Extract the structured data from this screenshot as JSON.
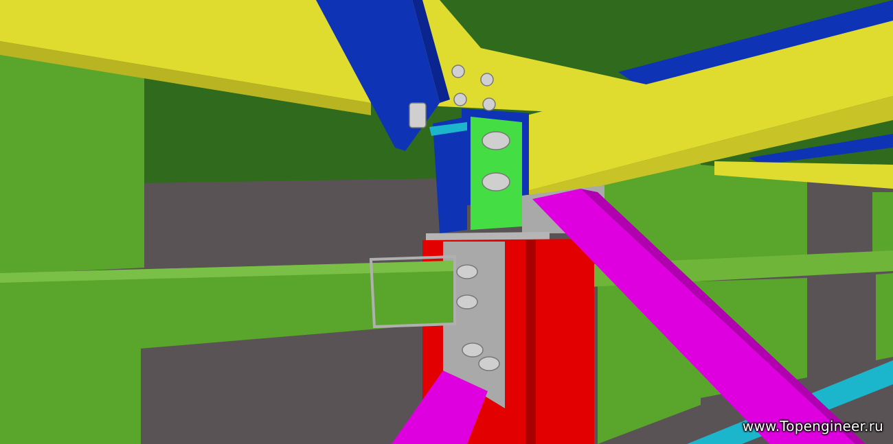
{
  "watermark": {
    "text": "www.Topengineer.ru"
  },
  "colors": {
    "background_wall": "#5a5355",
    "green_members": "#5aa52c",
    "yellow_beams": "#e0dc2f",
    "blue_members": "#0f33b5",
    "red_column": "#e20000",
    "magenta_braces": "#df00df",
    "bright_green_plate": "#44dd44",
    "cyan_strip": "#1cb6cc",
    "steel_plates": "#a9a9a9",
    "dark_green_deck": "#2f6a1d"
  }
}
